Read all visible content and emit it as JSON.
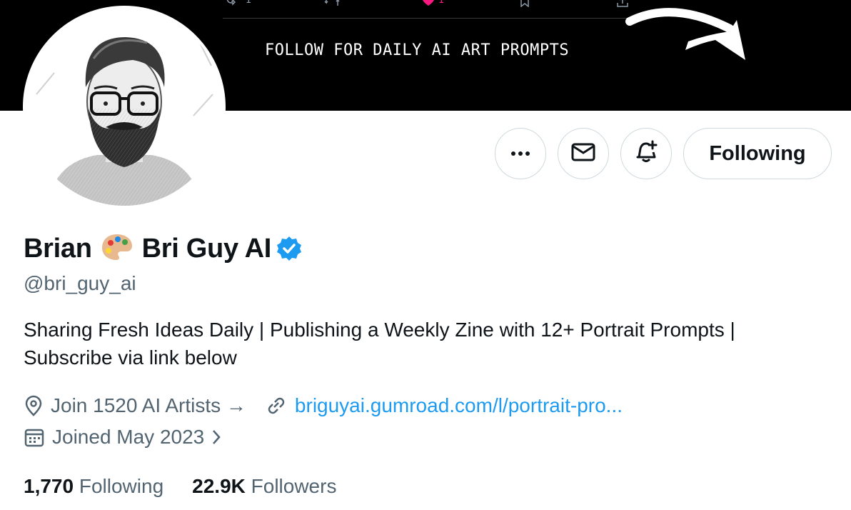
{
  "banner": {
    "text": "FOLLOW FOR DAILY AI ART PROMPTS",
    "tweet_actions": {
      "reply_count": "1",
      "like_count": "1"
    },
    "arrow_icon": "curved-arrow-icon"
  },
  "colors": {
    "accent": "#1d9bf0",
    "like": "#f91880",
    "muted_text": "#536471",
    "border": "#cfd9de"
  },
  "actions": {
    "more_icon": "more-icon",
    "message_icon": "envelope-icon",
    "notify_icon": "bell-plus-icon",
    "following_label": "Following"
  },
  "profile": {
    "name_first": "Brian",
    "name_emoji_icon": "artist-palette-icon",
    "name_rest": "Bri Guy AI",
    "verified_icon": "verified-badge-icon",
    "handle": "@bri_guy_ai",
    "bio_line1": "Sharing Fresh Ideas Daily | Publishing a Weekly Zine with 12+ Portrait Prompts |",
    "bio_line2": "Subscribe via link below",
    "location": "Join 1520 AI Artists →",
    "website": "briguyai.gumroad.com/l/portrait-pro...",
    "joined": "Joined May 2023"
  },
  "stats": {
    "following_count": "1,770",
    "following_label": "Following",
    "followers_count": "22.9K",
    "followers_label": "Followers"
  }
}
